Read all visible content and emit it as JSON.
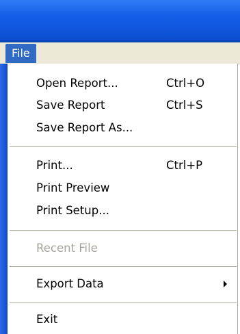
{
  "menubar": {
    "file_label": "File"
  },
  "menu": {
    "items": [
      {
        "label": "Open Report...",
        "shortcut": "Ctrl+O",
        "enabled": true
      },
      {
        "label": "Save Report",
        "shortcut": "Ctrl+S",
        "enabled": true
      },
      {
        "label": "Save Report As...",
        "shortcut": "",
        "enabled": true
      },
      {
        "label": "Print...",
        "shortcut": "Ctrl+P",
        "enabled": true
      },
      {
        "label": "Print Preview",
        "shortcut": "",
        "enabled": true
      },
      {
        "label": "Print Setup...",
        "shortcut": "",
        "enabled": true
      },
      {
        "label": "Recent File",
        "shortcut": "",
        "enabled": false
      },
      {
        "label": "Export Data",
        "shortcut": "",
        "enabled": true,
        "submenu": true
      },
      {
        "label": "Exit",
        "shortcut": "",
        "enabled": true
      }
    ]
  },
  "colors": {
    "titlebar": "#0d55dc",
    "menubar": "#ece9d8",
    "highlight": "#316ac5",
    "disabled_text": "#a7a59a",
    "separator": "#aca899"
  }
}
